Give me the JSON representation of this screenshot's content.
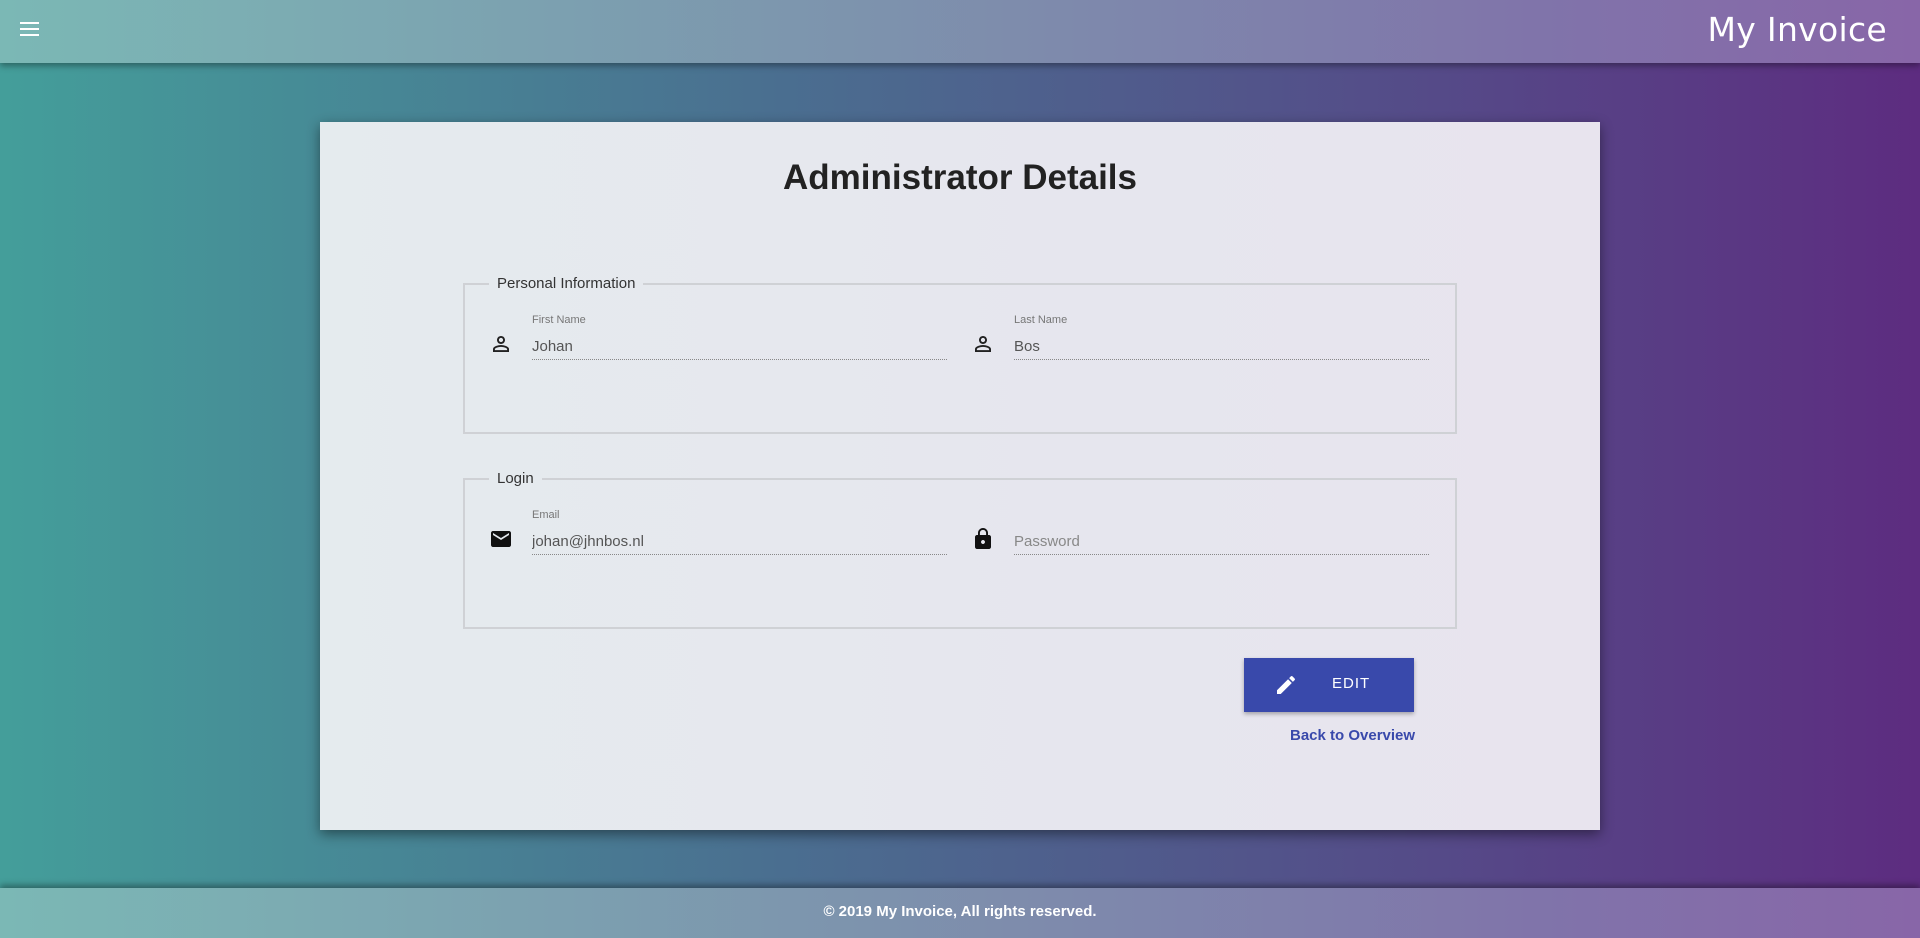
{
  "header": {
    "app_title": "My Invoice",
    "menu_icon": "menu-icon"
  },
  "card": {
    "title": "Administrator Details",
    "personal_info": {
      "legend": "Personal Information",
      "first_name": {
        "label": "First Name",
        "value": "Johan",
        "icon": "person-icon"
      },
      "last_name": {
        "label": "Last Name",
        "value": "Bos",
        "icon": "person-icon"
      }
    },
    "login": {
      "legend": "Login",
      "email": {
        "label": "Email",
        "value": "johan@jhnbos.nl",
        "icon": "mail-icon"
      },
      "password": {
        "placeholder": "Password",
        "icon": "lock-icon"
      }
    },
    "edit_button": {
      "label": "EDIT",
      "icon": "pencil-icon",
      "color": "#3949ab"
    },
    "back_link": "Back to Overview"
  },
  "footer": {
    "copyright": "© 2019 My Invoice, All rights reserved."
  }
}
